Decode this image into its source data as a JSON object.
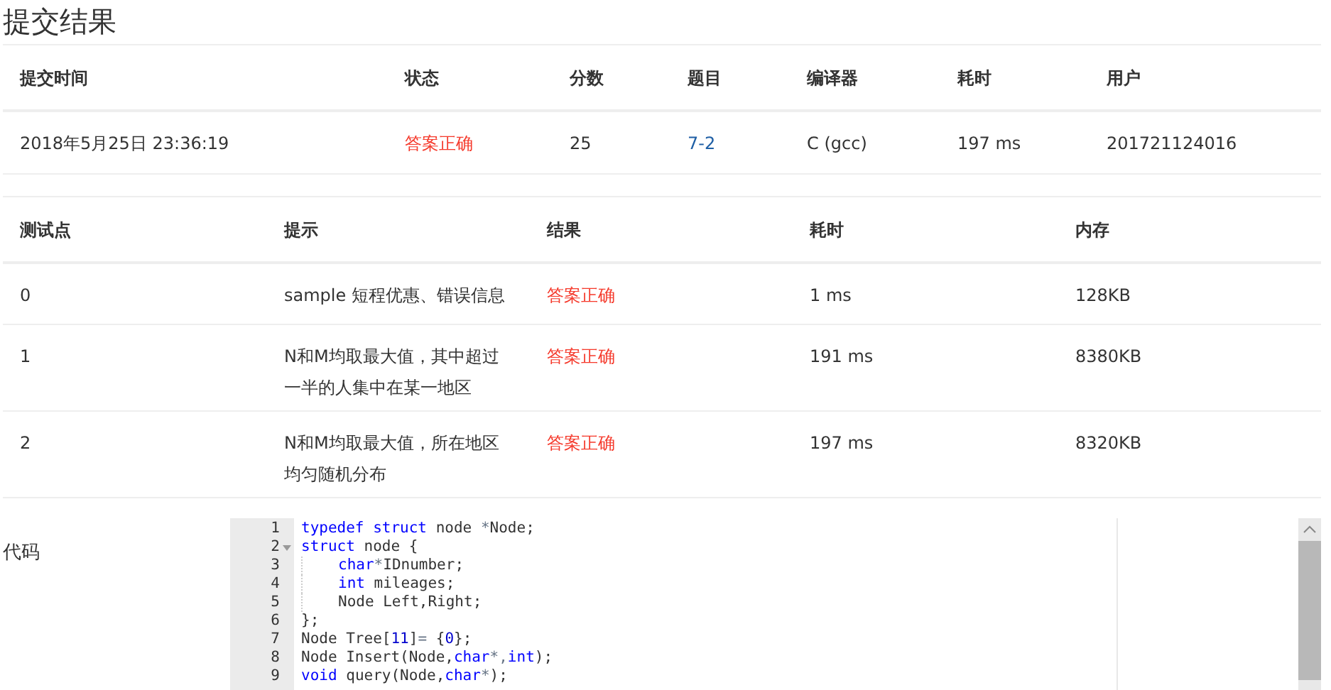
{
  "title": "提交结果",
  "submission": {
    "columns": [
      "提交时间",
      "状态",
      "分数",
      "题目",
      "编译器",
      "耗时",
      "用户"
    ],
    "row": {
      "time": "2018年5月25日 23:36:19",
      "status": "答案正确",
      "score": "25",
      "problem": "7-2",
      "compiler": "C (gcc)",
      "elapsed": "197 ms",
      "user": "201721124016"
    }
  },
  "tests": {
    "columns": [
      "测试点",
      "提示",
      "结果",
      "耗时",
      "内存"
    ],
    "rows": [
      {
        "id": "0",
        "hint": "sample 短程优惠、错误信息",
        "result": "答案正确",
        "time": "1 ms",
        "memory": "128KB"
      },
      {
        "id": "1",
        "hint": "N和M均取最大值，其中超过一半的人集中在某一地区",
        "result": "答案正确",
        "time": "191 ms",
        "memory": "8380KB"
      },
      {
        "id": "2",
        "hint": "N和M均取最大值，所在地区均匀随机分布",
        "result": "答案正确",
        "time": "197 ms",
        "memory": "8320KB"
      }
    ]
  },
  "code": {
    "label": "代码",
    "lines": [
      {
        "number": "1",
        "indent": false,
        "foldable": false,
        "tokens": [
          {
            "text": "typedef struct",
            "kind": "keyword"
          },
          {
            "text": " node ",
            "kind": "plain"
          },
          {
            "text": "*",
            "kind": "operator"
          },
          {
            "text": "Node;",
            "kind": "plain"
          }
        ]
      },
      {
        "number": "2",
        "indent": false,
        "foldable": true,
        "tokens": [
          {
            "text": "struct",
            "kind": "keyword"
          },
          {
            "text": " node {",
            "kind": "plain"
          }
        ]
      },
      {
        "number": "3",
        "indent": true,
        "foldable": false,
        "tokens": [
          {
            "text": "char",
            "kind": "keyword"
          },
          {
            "text": "*",
            "kind": "operator"
          },
          {
            "text": "IDnumber;",
            "kind": "plain"
          }
        ]
      },
      {
        "number": "4",
        "indent": true,
        "foldable": false,
        "tokens": [
          {
            "text": "int",
            "kind": "keyword"
          },
          {
            "text": " mileages;",
            "kind": "plain"
          }
        ]
      },
      {
        "number": "5",
        "indent": true,
        "foldable": false,
        "tokens": [
          {
            "text": "Node Left,Right;",
            "kind": "plain"
          }
        ]
      },
      {
        "number": "6",
        "indent": false,
        "foldable": false,
        "tokens": [
          {
            "text": "};",
            "kind": "plain"
          }
        ]
      },
      {
        "number": "7",
        "indent": false,
        "foldable": false,
        "tokens": [
          {
            "text": "Node Tree[",
            "kind": "plain"
          },
          {
            "text": "11",
            "kind": "number"
          },
          {
            "text": "]",
            "kind": "plain"
          },
          {
            "text": "=",
            "kind": "operator"
          },
          {
            "text": " {",
            "kind": "plain"
          },
          {
            "text": "0",
            "kind": "number"
          },
          {
            "text": "};",
            "kind": "plain"
          }
        ]
      },
      {
        "number": "8",
        "indent": false,
        "foldable": false,
        "tokens": [
          {
            "text": "Node Insert(Node,",
            "kind": "plain"
          },
          {
            "text": "char",
            "kind": "keyword"
          },
          {
            "text": "*,",
            "kind": "operator"
          },
          {
            "text": "int",
            "kind": "keyword"
          },
          {
            "text": ");",
            "kind": "plain"
          }
        ]
      },
      {
        "number": "9",
        "indent": false,
        "foldable": false,
        "tokens": [
          {
            "text": "void",
            "kind": "keyword"
          },
          {
            "text": " query(Node,",
            "kind": "plain"
          },
          {
            "text": "char",
            "kind": "keyword"
          },
          {
            "text": "*",
            "kind": "operator"
          },
          {
            "text": ");",
            "kind": "plain"
          }
        ]
      }
    ]
  }
}
